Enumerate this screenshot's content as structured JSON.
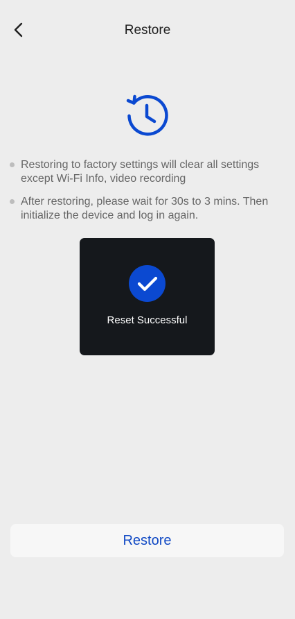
{
  "header": {
    "title": "Restore",
    "back_icon": "chevron-left-icon"
  },
  "hero": {
    "icon": "history-icon",
    "icon_color": "#0B49D1"
  },
  "notes": [
    {
      "text": "Restoring to factory settings will clear all settings except Wi-Fi Info, video recording"
    },
    {
      "text": "After restoring, please wait for 30s to 3 mins. Then initialize the device and log in again."
    }
  ],
  "toast": {
    "icon": "check-circle-icon",
    "message": "Reset Successful"
  },
  "footer": {
    "restore_label": "Restore",
    "accent_color": "#1049C4"
  }
}
